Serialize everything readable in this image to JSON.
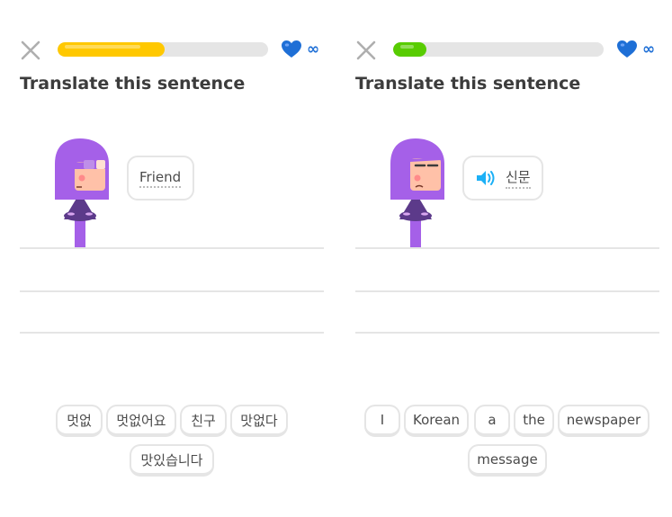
{
  "colors": {
    "progress_yellow": "#FFC800",
    "progress_green": "#58CC02",
    "heart_blue": "#1CB0F6",
    "character_purple": "#A560E8"
  },
  "left_panel": {
    "close_icon": "close-icon",
    "progress_fraction": 0.51,
    "hearts_value": "∞",
    "title": "Translate this sentence",
    "prompt_text": "Friend",
    "word_bank": [
      "멋없",
      "멋없어요",
      "친구",
      "맛없다",
      "맛있습니다"
    ]
  },
  "right_panel": {
    "close_icon": "close-icon",
    "progress_fraction": 0.16,
    "hearts_value": "∞",
    "title": "Translate this sentence",
    "prompt_text": "신문",
    "speaker_icon": "speaker-icon",
    "word_bank": [
      "I",
      "Korean",
      "a",
      "the",
      "newspaper",
      "message"
    ]
  }
}
